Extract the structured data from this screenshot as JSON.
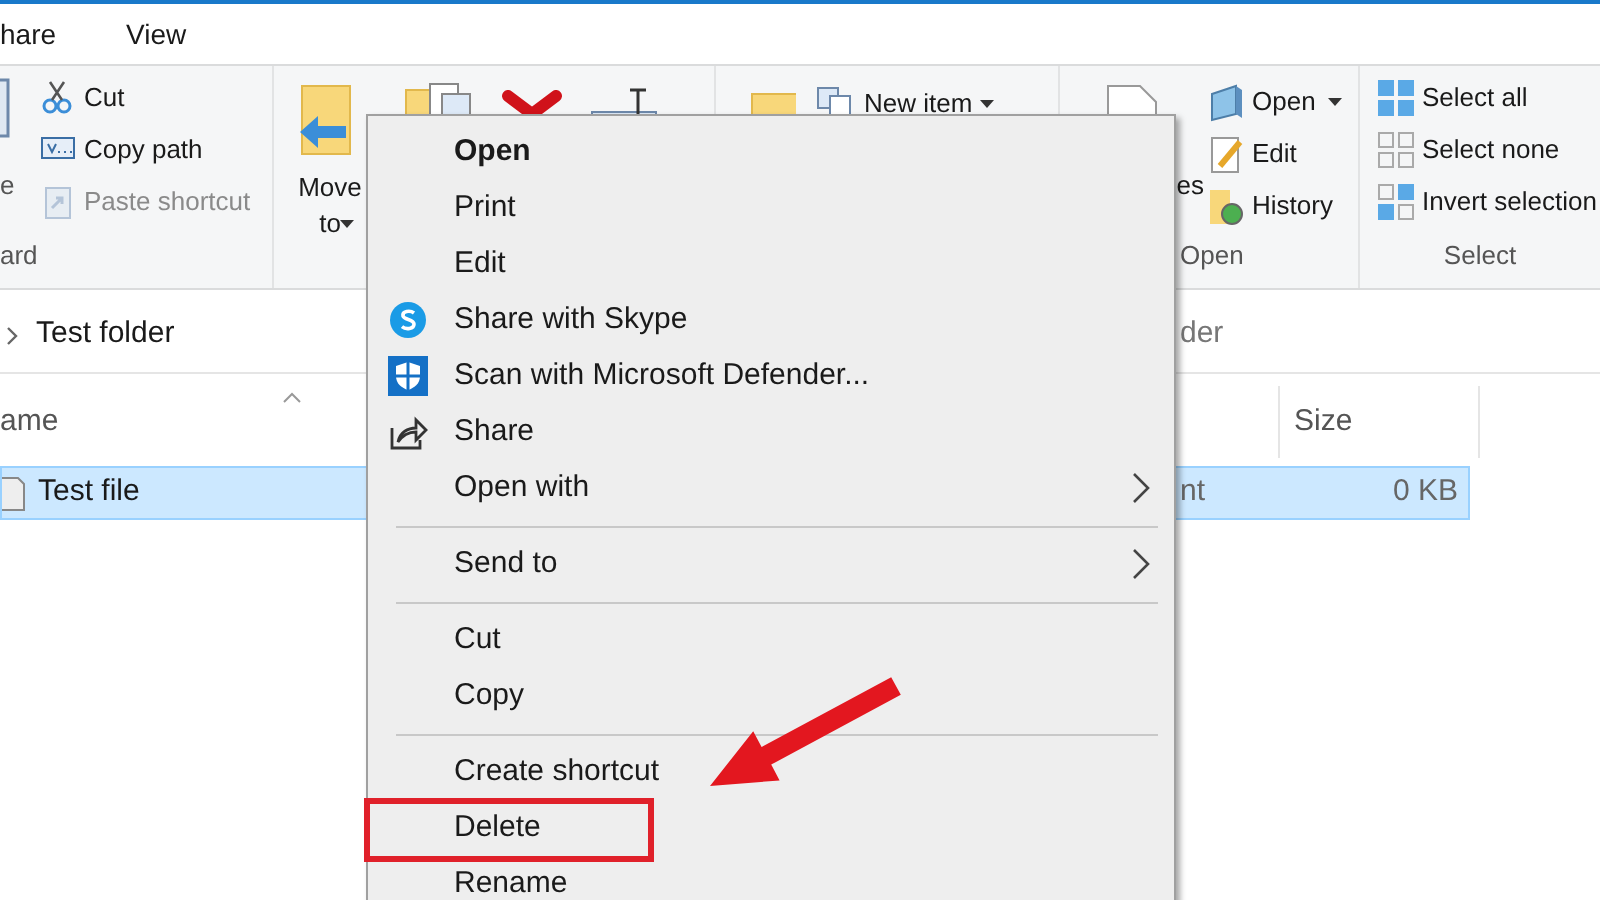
{
  "ribbon_tabs": [
    {
      "label": "hare",
      "selected": false
    },
    {
      "label": "View",
      "selected": false
    }
  ],
  "clipboard_group": {
    "label": "ard",
    "large_button": "e",
    "items": [
      {
        "label": "Cut",
        "disabled": false
      },
      {
        "label": "Copy path",
        "disabled": false
      },
      {
        "label": "Paste shortcut",
        "disabled": true
      }
    ]
  },
  "organize_group": {
    "move_to": "Move to"
  },
  "new_group": {
    "new_item": "New item"
  },
  "open_group": {
    "label": "Open",
    "properties": "es",
    "items": [
      {
        "label": "Open",
        "has_menu": true
      },
      {
        "label": "Edit",
        "has_menu": false
      },
      {
        "label": "History",
        "has_menu": false
      }
    ]
  },
  "select_group": {
    "label": "Select",
    "items": [
      "Select all",
      "Select none",
      "Invert selection"
    ]
  },
  "address_bar": {
    "path": "Test folder"
  },
  "search": {
    "placeholder": "der"
  },
  "file_list": {
    "columns": [
      "ame",
      "Size"
    ],
    "rows": [
      {
        "name": "Test file",
        "type": "nt",
        "size": "0 KB",
        "selected": true
      }
    ]
  },
  "context_menu": {
    "items": [
      {
        "kind": "item",
        "label": "Open",
        "default": true,
        "highlighted": false
      },
      {
        "kind": "item",
        "label": "Print",
        "default": false,
        "highlighted": false
      },
      {
        "kind": "item",
        "label": "Edit",
        "default": false,
        "highlighted": false
      },
      {
        "kind": "item",
        "label": "Share with Skype",
        "default": false,
        "highlighted": false
      },
      {
        "kind": "item",
        "label": "Scan with Microsoft Defender...",
        "default": false,
        "highlighted": false
      },
      {
        "kind": "item",
        "label": "Share",
        "default": false,
        "highlighted": false
      },
      {
        "kind": "submenu",
        "label": "Open with",
        "default": false,
        "highlighted": false
      },
      {
        "kind": "separator"
      },
      {
        "kind": "submenu",
        "label": "Send to",
        "default": false,
        "highlighted": false
      },
      {
        "kind": "separator"
      },
      {
        "kind": "item",
        "label": "Cut",
        "default": false,
        "highlighted": false
      },
      {
        "kind": "item",
        "label": "Copy",
        "default": false,
        "highlighted": false
      },
      {
        "kind": "separator"
      },
      {
        "kind": "item",
        "label": "Create shortcut",
        "default": false,
        "highlighted": false
      },
      {
        "kind": "item",
        "label": "Delete",
        "default": false,
        "highlighted": true
      },
      {
        "kind": "item",
        "label": "Rename",
        "default": false,
        "highlighted": false
      }
    ]
  }
}
